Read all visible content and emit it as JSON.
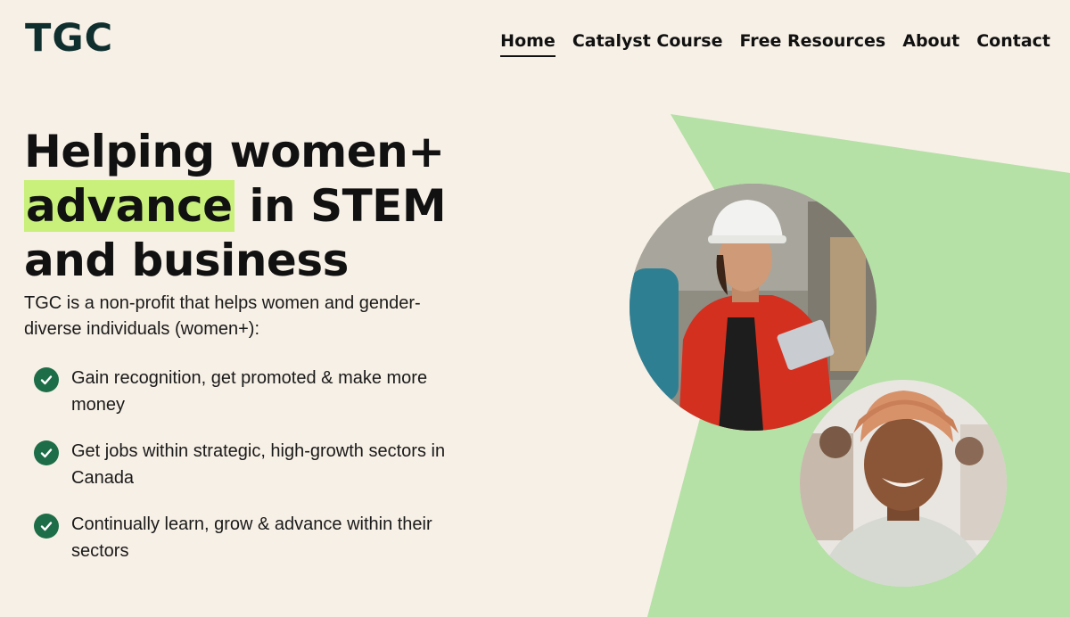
{
  "header": {
    "logo": "TGC",
    "nav": [
      {
        "label": "Home",
        "active": true
      },
      {
        "label": "Catalyst Course",
        "active": false
      },
      {
        "label": "Free Resources",
        "active": false
      },
      {
        "label": "About",
        "active": false
      },
      {
        "label": "Contact",
        "active": false
      }
    ]
  },
  "hero": {
    "title_line1": "Helping women+",
    "title_highlight": "advance",
    "title_line2_rest": " in STEM",
    "title_line3": "and business",
    "intro": "TGC is a non-profit that helps women and gender-diverse individuals (women+):",
    "benefits": [
      "Gain recognition, get promoted & make more money",
      "Get jobs within strategic, high-growth sectors in Canada",
      "Continually learn, grow & advance within their sectors"
    ]
  },
  "colors": {
    "background": "#f7f0e6",
    "highlight": "#c8f07a",
    "green_shape": "#b5e0a6",
    "check": "#1d6e48"
  }
}
